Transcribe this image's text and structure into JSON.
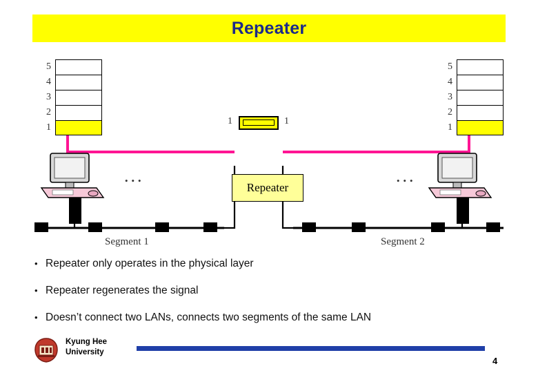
{
  "slide": {
    "title": "Repeater",
    "page_number": "4",
    "title_bg": "#ffff00",
    "title_color": "#1b2a8a",
    "accent_rule_color": "#1f3fa8"
  },
  "figure": {
    "left_stack_labels": [
      "5",
      "4",
      "3",
      "2",
      "1"
    ],
    "right_stack_labels": [
      "5",
      "4",
      "3",
      "2",
      "1"
    ],
    "repeater_left_label": "1",
    "repeater_right_label": "1",
    "repeater_box_label": "Repeater",
    "segment_left_label": "Segment 1",
    "segment_right_label": "Segment 2",
    "ellipsis_left": "...",
    "ellipsis_right": "...",
    "signal_color": "#ff1493",
    "highlight_color": "#ffff00"
  },
  "bullets": [
    {
      "marker": "•",
      "text": "Repeater only operates in the physical layer"
    },
    {
      "marker": "•",
      "text": "Repeater regenerates the signal"
    },
    {
      "marker": "•",
      "text": "Doesn’t connect two LANs, connects two segments of the same LAN"
    }
  ],
  "footer": {
    "university_line1": "Kyung Hee",
    "university_line2": "University"
  }
}
